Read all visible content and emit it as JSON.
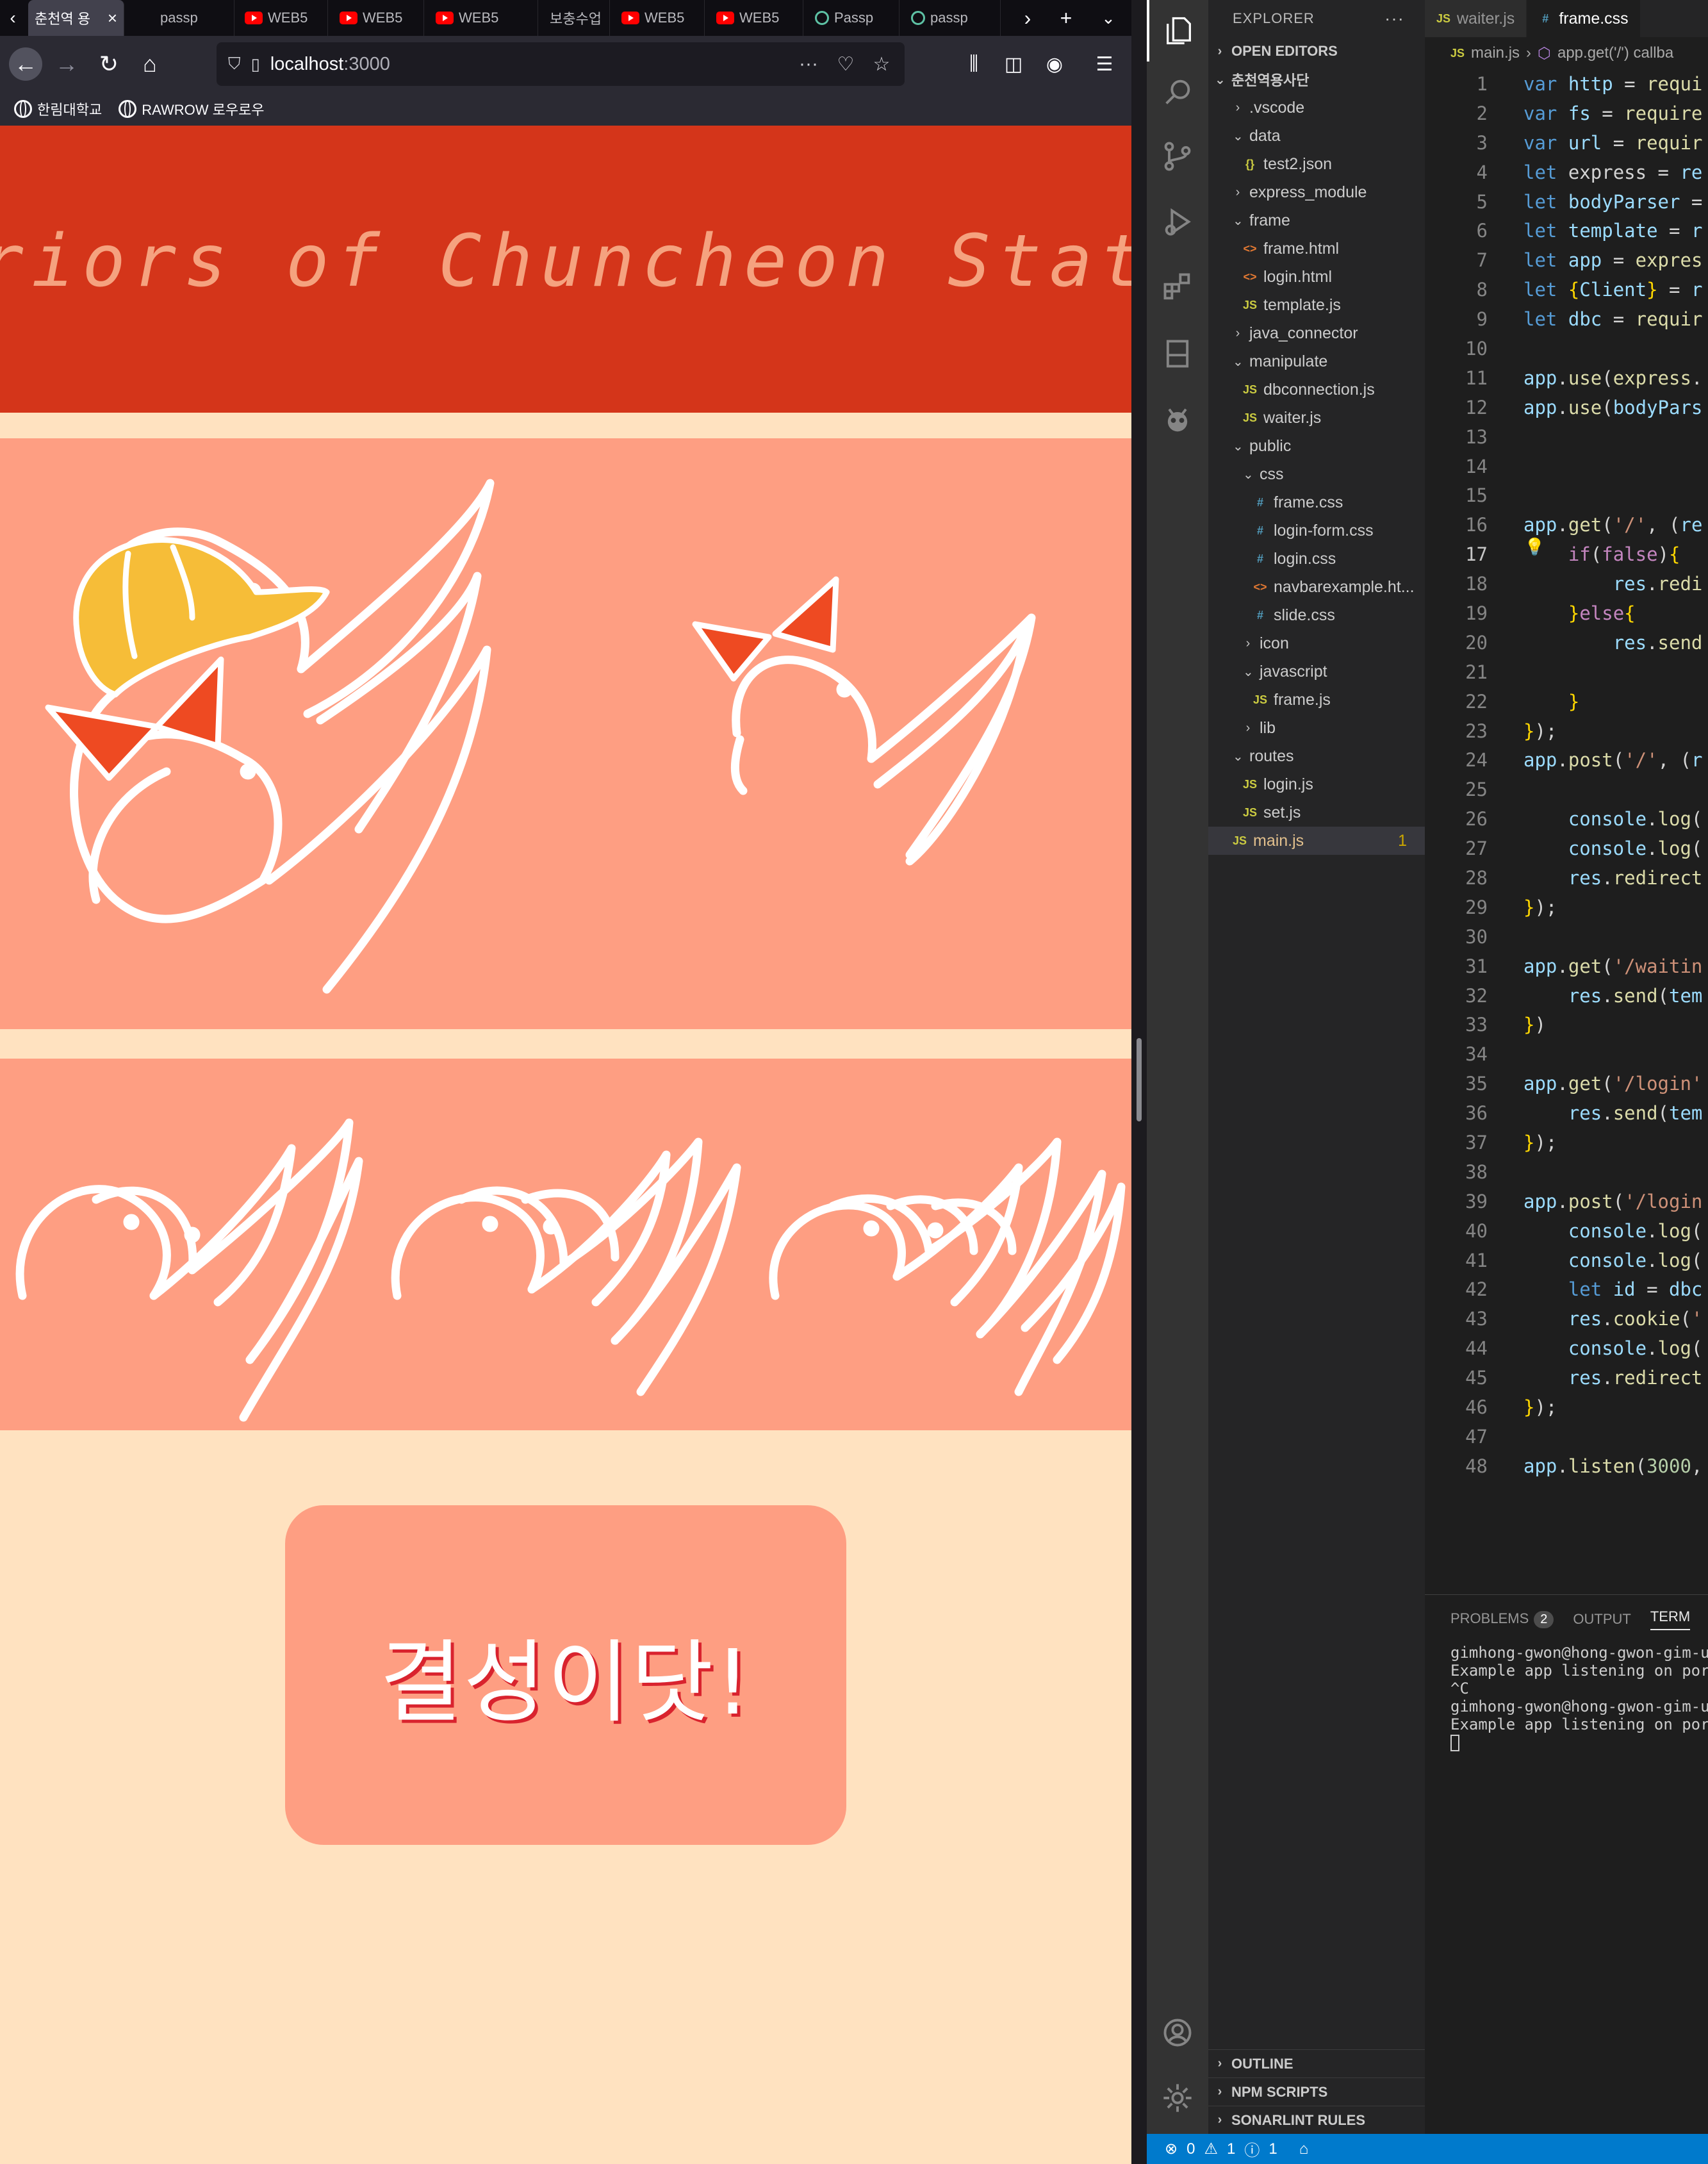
{
  "browser": {
    "tabs": [
      {
        "label": "춘천역 용",
        "icon": "page-icon",
        "active": true
      },
      {
        "label": "passp",
        "icon": "none"
      },
      {
        "label": "WEB5",
        "icon": "youtube-icon"
      },
      {
        "label": "WEB5",
        "icon": "youtube-icon"
      },
      {
        "label": "WEB5",
        "icon": "youtube-icon"
      },
      {
        "label": "보충수업",
        "icon": "none"
      },
      {
        "label": "WEB5",
        "icon": "youtube-icon"
      },
      {
        "label": "WEB5",
        "icon": "youtube-icon"
      },
      {
        "label": "Passp",
        "icon": "passport-icon"
      },
      {
        "label": "passp",
        "icon": "passport-icon"
      }
    ],
    "url_host": "localhost",
    "url_port": ":3000",
    "bookmarks": [
      {
        "label": "한림대학교"
      },
      {
        "label": "RAWROW 로우로우"
      }
    ]
  },
  "page": {
    "title": "Worriors of Chuncheon Station",
    "cta_label": "결성이닷!"
  },
  "colors": {
    "header_red": "#d4351a",
    "band_salmon": "#fe9e82",
    "background_cream": "#ffe2c0",
    "cap_yellow": "#f6bd38",
    "ribbon_orange": "#ee4a22",
    "cta_shadow": "#d9232e",
    "vscode_status_blue": "#007acc"
  },
  "vscode": {
    "explorer_title": "EXPLORER",
    "open_editors": "OPEN EDITORS",
    "workspace": "춘천역용사단",
    "tree": [
      {
        "label": ".vscode",
        "type": "folder",
        "depth": 1,
        "open": false
      },
      {
        "label": "data",
        "type": "folder",
        "depth": 1,
        "open": true
      },
      {
        "label": "test2.json",
        "type": "json",
        "depth": 2
      },
      {
        "label": "express_module",
        "type": "folder",
        "depth": 1,
        "open": false
      },
      {
        "label": "frame",
        "type": "folder",
        "depth": 1,
        "open": true
      },
      {
        "label": "frame.html",
        "type": "html",
        "depth": 2
      },
      {
        "label": "login.html",
        "type": "html",
        "depth": 2
      },
      {
        "label": "template.js",
        "type": "js",
        "depth": 2
      },
      {
        "label": "java_connector",
        "type": "folder",
        "depth": 1,
        "open": false
      },
      {
        "label": "manipulate",
        "type": "folder",
        "depth": 1,
        "open": true
      },
      {
        "label": "dbconnection.js",
        "type": "js",
        "depth": 2
      },
      {
        "label": "waiter.js",
        "type": "js",
        "depth": 2
      },
      {
        "label": "public",
        "type": "folder",
        "depth": 1,
        "open": true
      },
      {
        "label": "css",
        "type": "folder",
        "depth": 2,
        "open": true
      },
      {
        "label": "frame.css",
        "type": "css",
        "depth": 3
      },
      {
        "label": "login-form.css",
        "type": "css",
        "depth": 3
      },
      {
        "label": "login.css",
        "type": "css",
        "depth": 3
      },
      {
        "label": "navbarexample.ht...",
        "type": "html",
        "depth": 3
      },
      {
        "label": "slide.css",
        "type": "css",
        "depth": 3
      },
      {
        "label": "icon",
        "type": "folder",
        "depth": 2,
        "open": false
      },
      {
        "label": "javascript",
        "type": "folder",
        "depth": 2,
        "open": true
      },
      {
        "label": "frame.js",
        "type": "js",
        "depth": 3
      },
      {
        "label": "lib",
        "type": "folder",
        "depth": 2,
        "open": false
      },
      {
        "label": "routes",
        "type": "folder",
        "depth": 1,
        "open": true
      },
      {
        "label": "login.js",
        "type": "js",
        "depth": 2
      },
      {
        "label": "set.js",
        "type": "js",
        "depth": 2
      },
      {
        "label": "main.js",
        "type": "js",
        "depth": 1,
        "active": true,
        "badge": "1"
      }
    ],
    "bottom_sections": [
      "OUTLINE",
      "NPM SCRIPTS",
      "SONARLINT RULES"
    ],
    "editor_tabs": [
      {
        "label": "waiter.js",
        "icon": "JS",
        "active": false
      },
      {
        "label": "frame.css",
        "icon": "#",
        "active": true
      }
    ],
    "breadcrumb": {
      "file": "main.js",
      "symbol": "app.get('/') callba"
    },
    "code_lines": [
      "var http = requi",
      "var fs = require",
      "var url = requir",
      "let express = re",
      "let bodyParser =",
      "let template = r",
      "let app = expres",
      "let {Client} = r",
      "let dbc = requir",
      "",
      "app.use(express.",
      "app.use(bodyPars",
      "",
      "",
      "",
      "app.get('/', (re",
      "    if(false){",
      "        res.redi",
      "    }else{",
      "        res.send",
      "",
      "    }",
      "});",
      "app.post('/', (r",
      "",
      "    console.log(",
      "    console.log(",
      "    res.redirect",
      "});",
      "",
      "app.get('/waitin",
      "    res.send(tem",
      "})",
      "",
      "app.get('/login'",
      "    res.send(tem",
      "});",
      "",
      "app.post('/login",
      "    console.log(",
      "    console.log(",
      "    let id = dbc",
      "    res.cookie('",
      "    console.log(",
      "    res.redirect",
      "});",
      "",
      "app.listen(3000,"
    ],
    "current_line": 17,
    "panel_tabs": {
      "problems": "PROBLEMS",
      "problems_count": "2",
      "output": "OUTPUT",
      "terminal": "TERM"
    },
    "terminal_lines": [
      "gimhong-gwon@hong-gwon-gim-ui",
      "Example app listening on port",
      "^C",
      "gimhong-gwon@hong-gwon-gim-ui",
      "Example app listening on port"
    ],
    "status": {
      "errors": "0",
      "warnings": "1",
      "infos": "1"
    }
  }
}
